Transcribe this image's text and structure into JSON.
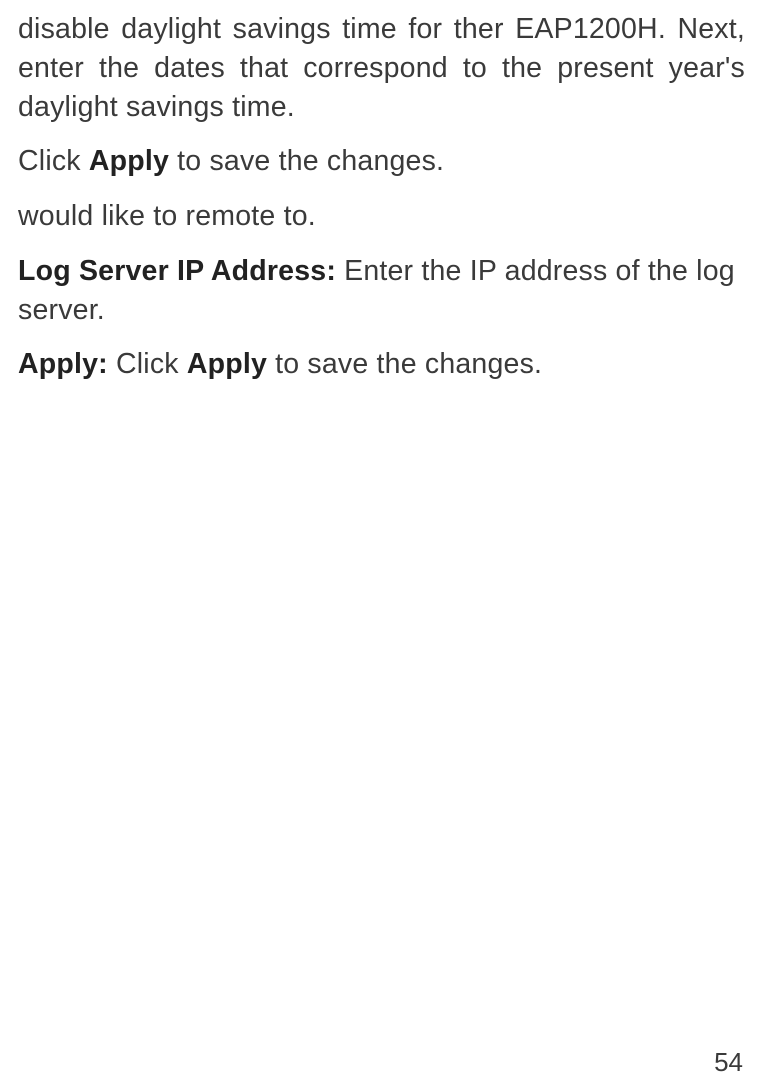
{
  "paragraphs": {
    "p1": "disable daylight savings time for ther EAP1200H. Next, enter the dates that correspond to the present year's daylight savings time.",
    "p2_pre": "Click ",
    "p2_bold": "Apply",
    "p2_post": " to save the changes.",
    "p3": "would like to remote to.",
    "p4_bold": "Log Server IP Address:",
    "p4_post": " Enter the IP address of the log server.",
    "p5_bold1": "Apply:",
    "p5_mid": " Click ",
    "p5_bold2": "Apply",
    "p5_post": " to save the changes."
  },
  "page_number": "54"
}
